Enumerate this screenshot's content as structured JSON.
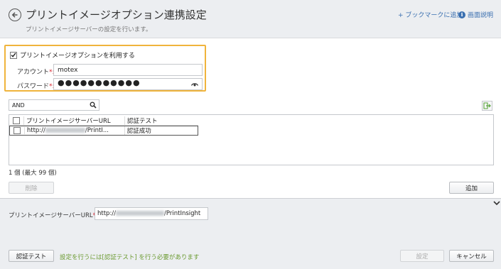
{
  "header": {
    "title": "プリントイメージオプション連携設定",
    "subtitle": "プリントイメージサーバーの設定を行います。",
    "bookmark_link": "+ ブックマークに追加",
    "help_link": "画面説明"
  },
  "settings": {
    "use_option_label": "プリントイメージオプションを利用する",
    "use_option_checked": true,
    "account_label": "アカウント",
    "account_value": "motex",
    "password_label": "パスワード",
    "password_value": "●●●●●●●●●●●",
    "required_mark": "*:"
  },
  "search": {
    "value": "AND"
  },
  "table": {
    "columns": [
      "プリントイメージサーバーURL",
      "認証テスト"
    ],
    "rows": [
      {
        "url_prefix": "http://",
        "url_suffix": "/PrintI...",
        "auth": "認証成功"
      }
    ]
  },
  "count_text": "1 個 (最大 99 個)",
  "buttons": {
    "delete": "削除",
    "add": "追加",
    "auth_test": "認証テスト",
    "ok": "設定",
    "cancel": "キャンセル"
  },
  "server": {
    "url_label": "プリントイメージサーバーURL",
    "url_prefix": "http://",
    "url_suffix": "/PrintInsight"
  },
  "auth_note": "設定を行うには[認証テスト] を行う必要があります",
  "colors": {
    "accent": "#f0b43c",
    "link": "#3a6fb0",
    "required": "#d9232d",
    "note": "#6a9a2f"
  }
}
